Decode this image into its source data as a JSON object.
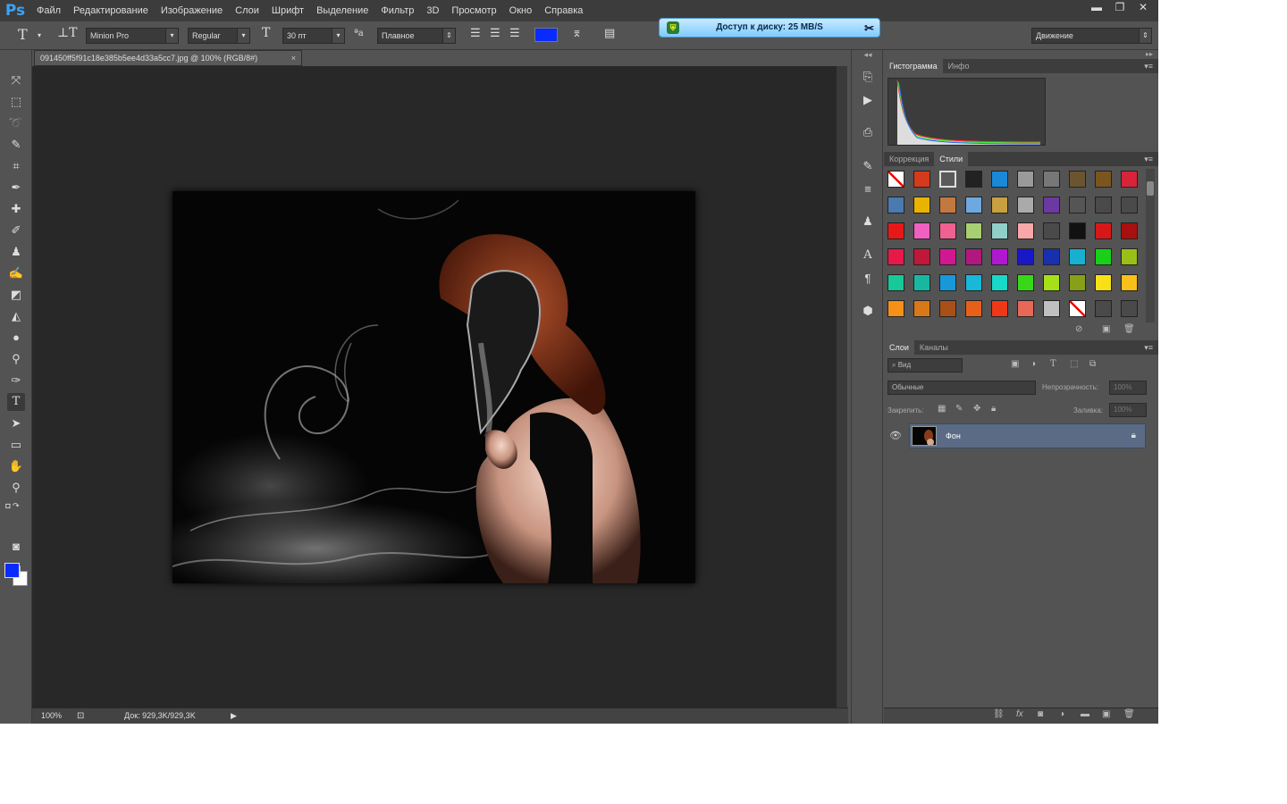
{
  "app": {
    "logo": "Ps"
  },
  "menubar": {
    "items": [
      "Файл",
      "Редактирование",
      "Изображение",
      "Слои",
      "Шрифт",
      "Выделение",
      "Фильтр",
      "3D",
      "Просмотр",
      "Окно",
      "Справка"
    ]
  },
  "window_controls": {
    "minimize": "▬",
    "maximize": "❐",
    "close": "✕"
  },
  "disk_notification": {
    "text": "Доступ к диску: 25 MB/S"
  },
  "options": {
    "font_family": "Minion Pro",
    "font_style": "Regular",
    "font_size": "30 пт",
    "antialias": "Плавное",
    "text_color": "#0a2bff",
    "workspace": "Движение"
  },
  "document": {
    "tab_title": "091450ff5f91c18e385b5ee4d33a5cc7.jpg @ 100% (RGB/8#)",
    "tab_close": "×",
    "zoom": "100%",
    "doc_size": "Док: 929,3K/929,3K"
  },
  "colors": {
    "foreground": "#0a2bff",
    "background": "#ffffff",
    "accent": "#3ba2f7"
  },
  "panels": {
    "top_tabs": [
      "Гистограмма",
      "Инфо"
    ],
    "mid_tabs": [
      "Коррекция",
      "Стили"
    ],
    "layer_tabs": [
      "Слои",
      "Каналы"
    ],
    "layer_filter": "Вид",
    "blend_mode": "Обычные",
    "opacity_label": "Непрозрачность:",
    "opacity_value": "100%",
    "lock_label": "Закрепить:",
    "fill_label": "Заливка:",
    "fill_value": "100%",
    "layers": [
      {
        "name": "Фон",
        "visible": true,
        "locked": true
      }
    ]
  },
  "style_swatches": [
    [
      "none",
      "#d63a1c",
      "#5a5a5a",
      "#222",
      "#1a88d8",
      "#9a9a9a",
      "#777",
      "#6b5530",
      "#7a5520",
      "#d8243a"
    ],
    [
      "#4a7ab0",
      "#e8b400",
      "#c27840",
      "#6fa8e0",
      "#c8a040",
      "#aaa",
      "#6a3aa0",
      "#555",
      "#4a4a4a",
      "#4a4a4a"
    ],
    [
      "#e81818",
      "#f060c0",
      "#f06090",
      "#a8d070",
      "#90d0c8",
      "#f8a8a8",
      "#4a4a4a",
      "#111",
      "#d81818",
      "#a81010"
    ],
    [
      "#e8184a",
      "#c01838",
      "#d01890",
      "#b01880",
      "#b018d0",
      "#1818c8",
      "#1830b0",
      "#18b0d0",
      "#18d018",
      "#98c018"
    ],
    [
      "#18c898",
      "#18b8a0",
      "#1898d8",
      "#18b8d8",
      "#18d8c8",
      "#38d818",
      "#a8e018",
      "#88a018",
      "#f8e018",
      "#f8c018"
    ],
    [
      "#f89018",
      "#d87818",
      "#a85018",
      "#e86018",
      "#f03818",
      "#e86858",
      "#c0c0c0",
      "none",
      "#4a4a4a",
      "#4a4a4a"
    ]
  ]
}
